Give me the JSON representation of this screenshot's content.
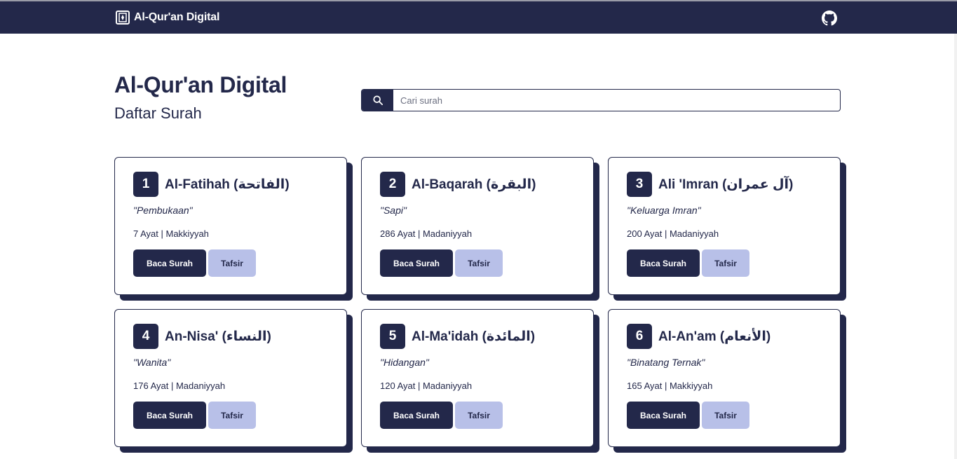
{
  "navbar": {
    "brand": "Al-Qur'an Digital",
    "brand_icon": "quran-book-icon",
    "github_icon": "github-icon"
  },
  "header": {
    "title": "Al-Qur'an Digital",
    "subtitle": "Daftar Surah"
  },
  "search": {
    "placeholder": "Cari surah",
    "value": "",
    "icon": "search-icon"
  },
  "surahs": [
    {
      "number": "1",
      "name": "Al-Fatihah (الفاتحة)",
      "meaning": "\"Pembukaan\"",
      "info": "7 Ayat | Makkiyyah",
      "read_label": "Baca Surah",
      "tafsir_label": "Tafsir"
    },
    {
      "number": "2",
      "name": "Al-Baqarah (البقرة)",
      "meaning": "\"Sapi\"",
      "info": "286 Ayat | Madaniyyah",
      "read_label": "Baca Surah",
      "tafsir_label": "Tafsir"
    },
    {
      "number": "3",
      "name": "Ali 'Imran (آل عمران)",
      "meaning": "\"Keluarga Imran\"",
      "info": "200 Ayat | Madaniyyah",
      "read_label": "Baca Surah",
      "tafsir_label": "Tafsir"
    },
    {
      "number": "4",
      "name": "An-Nisa' (النساء)",
      "meaning": "\"Wanita\"",
      "info": "176 Ayat | Madaniyyah",
      "read_label": "Baca Surah",
      "tafsir_label": "Tafsir"
    },
    {
      "number": "5",
      "name": "Al-Ma'idah (المائدة)",
      "meaning": "\"Hidangan\"",
      "info": "120 Ayat | Madaniyyah",
      "read_label": "Baca Surah",
      "tafsir_label": "Tafsir"
    },
    {
      "number": "6",
      "name": "Al-An'am (الأنعام)",
      "meaning": "\"Binatang Ternak\"",
      "info": "165 Ayat | Makkiyyah",
      "read_label": "Baca Surah",
      "tafsir_label": "Tafsir"
    }
  ],
  "colors": {
    "primary": "#23284a",
    "secondary": "#b8c0e8",
    "background": "#ffffff"
  }
}
